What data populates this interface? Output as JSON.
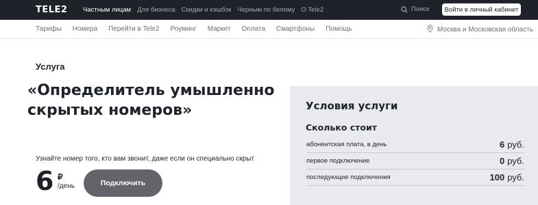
{
  "header": {
    "logo": "TELE2",
    "nav": [
      {
        "label": "Частным лицам",
        "active": true
      },
      {
        "label": "Для бизнеса",
        "active": false
      },
      {
        "label": "Скидки и кэшбэк",
        "active": false
      },
      {
        "label": "Черным по белому",
        "active": false
      },
      {
        "label": "О Tele2",
        "active": false
      }
    ],
    "search_label": "Поиск",
    "cabinet_button": "Войти в личный кабинет"
  },
  "subnav": {
    "items": [
      "Тарифы",
      "Номера",
      "Перейти в Tele2",
      "Роуминг",
      "Маркет",
      "Оплата",
      "Смартфоны",
      "Помощь"
    ],
    "region": "Москва и Московская область"
  },
  "main": {
    "label": "Услуга",
    "title": "«Определитель умышленно скрытых номеров»",
    "description": "Узнайте номер того, кто вам звонит, даже если он специально скрыт",
    "price_value": "6",
    "price_currency": "₽",
    "price_period": "/день",
    "connect_button": "Подключить"
  },
  "conditions": {
    "title": "Условия услуги",
    "subtitle": "Сколько стоит",
    "rows": [
      {
        "label": "абонентская плата, в день",
        "value": "6",
        "unit": "руб."
      },
      {
        "label": "первое подключение",
        "value": "0",
        "unit": "руб."
      },
      {
        "label": "последующие подключения",
        "value": "100",
        "unit": "руб."
      }
    ]
  },
  "colors": {
    "header_bg": "#1f2229",
    "panel_bg": "#e9eaee",
    "button_bg": "#626469"
  }
}
